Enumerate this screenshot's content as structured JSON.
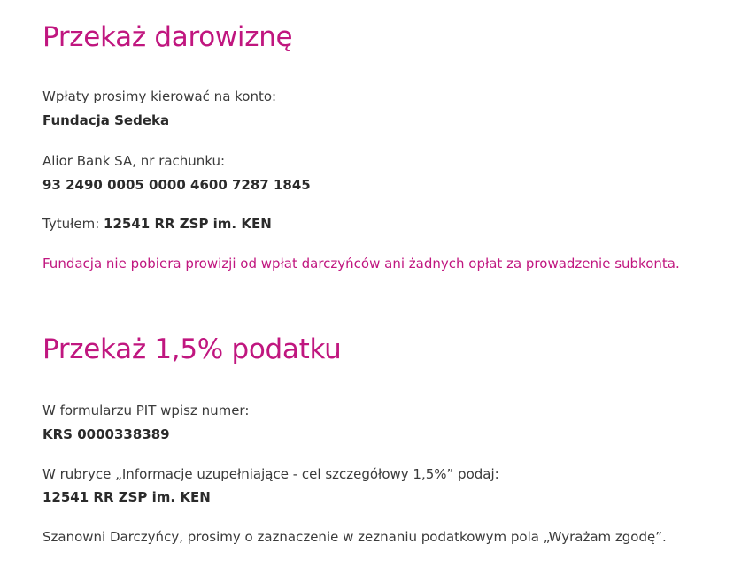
{
  "colors": {
    "accent": "#c0167f",
    "text": "#3a3a3a",
    "text_strong": "#2b2b2b",
    "background": "#ffffff"
  },
  "donation": {
    "title": "Przekaż darowiznę",
    "account_intro": "Wpłaty prosimy kierować na konto:",
    "recipient": "Fundacja Sedeka",
    "bank_label": "Alior Bank SA, nr rachunku:",
    "account_number": "93 2490 0005 0000 4600 7287 1845",
    "title_label": "Tytułem: ",
    "title_value": "12541 RR ZSP im. KEN",
    "fee_note": "Fundacja nie pobiera prowizji od wpłat darczyńców ani żadnych opłat za prowadzenie subkonta."
  },
  "tax": {
    "title": "Przekaż 1,5% podatku",
    "pit_intro": "W formularzu PIT wpisz numer:",
    "krs": "KRS 0000338389",
    "rubric_intro": "W rubryce „Informacje uzupełniające - cel szczegółowy 1,5%” podaj:",
    "rubric_value": "12541 RR ZSP im. KEN",
    "consent_note": "Szanowni Darczyńcy, prosimy o zaznaczenie w zeznaniu podatkowym pola „Wyrażam zgodę”."
  }
}
